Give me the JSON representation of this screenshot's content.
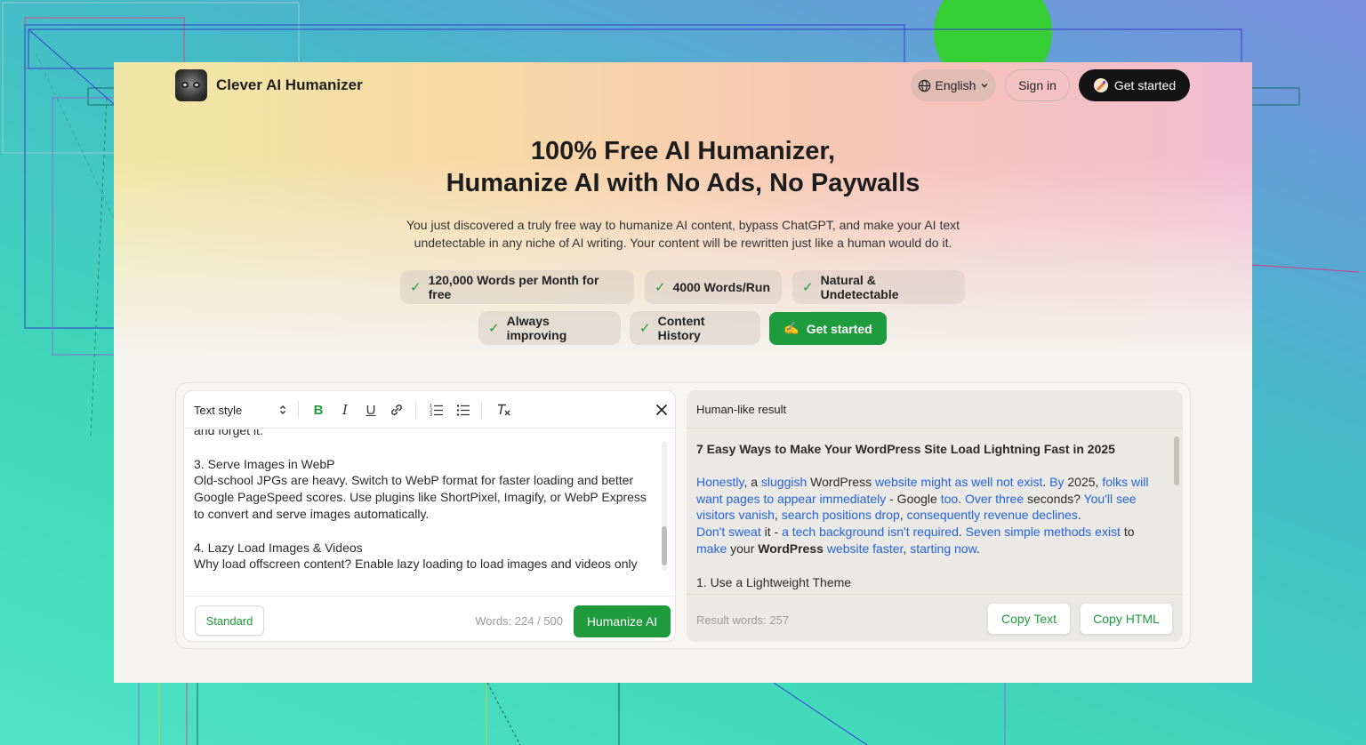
{
  "brand": {
    "name": "Clever AI Humanizer"
  },
  "header": {
    "language": "English",
    "sign_in": "Sign in",
    "get_started": "Get started"
  },
  "hero": {
    "title_line1": "100% Free AI Humanizer,",
    "title_line2": "Humanize AI with No Ads, No Paywalls",
    "subtitle_line1": "You just discovered a truly free way to humanize AI content, bypass ChatGPT, and make your AI text",
    "subtitle_line2": "undetectable in any niche of AI writing. Your content will be rewritten just like a human would do it."
  },
  "features": [
    "120,000 Words per Month for free",
    "4000 Words/Run",
    "Natural & Undetectable",
    "Always improving",
    "Content History"
  ],
  "cta": {
    "label": "Get started",
    "icon": "✍️"
  },
  "editor": {
    "text_style": "Text style",
    "lines": [
      "and forget it.",
      "",
      "3. Serve Images in WebP",
      "Old-school JPGs are heavy. Switch to WebP format for faster loading and better Google PageSpeed scores. Use plugins like ShortPixel, Imagify, or WebP Express to convert and serve images automatically.",
      "",
      "4. Lazy Load Images & Videos",
      "Why load offscreen content? Enable lazy loading to load images and videos only"
    ],
    "mode": "Standard",
    "word_count": "Words: 224 / 500",
    "humanize_label": "Humanize AI"
  },
  "result": {
    "header": "Human-like result",
    "heading": "7 Easy Ways to Make Your WordPress Site Load Lightning Fast in 2025",
    "paragraph": [
      {
        "t": "Honestly",
        "h": true
      },
      {
        "t": ", a ",
        "h": false
      },
      {
        "t": "sluggish",
        "h": true
      },
      {
        "t": " WordPress ",
        "h": false
      },
      {
        "t": "website might as well not exist",
        "h": true
      },
      {
        "t": ". ",
        "h": false
      },
      {
        "t": "By",
        "h": true
      },
      {
        "t": " 2025, ",
        "h": false
      },
      {
        "t": "folks will want pages to appear immediately",
        "h": true
      },
      {
        "t": " - Google ",
        "h": false
      },
      {
        "t": "too",
        "h": true
      },
      {
        "t": ". ",
        "h": false
      },
      {
        "t": "Over three",
        "h": true
      },
      {
        "t": " seconds? ",
        "h": false
      },
      {
        "t": "You'll see visitors vanish",
        "h": true
      },
      {
        "t": ", ",
        "h": false
      },
      {
        "t": "search positions drop",
        "h": true
      },
      {
        "t": ", ",
        "h": false
      },
      {
        "t": "consequently revenue declines",
        "h": true
      },
      {
        "t": ".",
        "h": false
      }
    ],
    "paragraph2": [
      {
        "t": "Don't sweat",
        "h": true
      },
      {
        "t": " it - ",
        "h": false
      },
      {
        "t": "a tech background isn't required",
        "h": true
      },
      {
        "t": ". ",
        "h": false
      },
      {
        "t": "Seven simple methods exist",
        "h": true
      },
      {
        "t": " to ",
        "h": false
      },
      {
        "t": "make",
        "h": true
      },
      {
        "t": " your ",
        "h": false
      },
      {
        "t": "WordPress",
        "h": false,
        "b": true
      },
      {
        "t": " ",
        "h": false
      },
      {
        "t": "website faster",
        "h": true
      },
      {
        "t": ", ",
        "h": false
      },
      {
        "t": "starting now",
        "h": true
      },
      {
        "t": ".",
        "h": false
      }
    ],
    "next_line": "1. Use a Lightweight Theme",
    "words": "Result words: 257",
    "copy_text": "Copy Text",
    "copy_html": "Copy HTML"
  }
}
